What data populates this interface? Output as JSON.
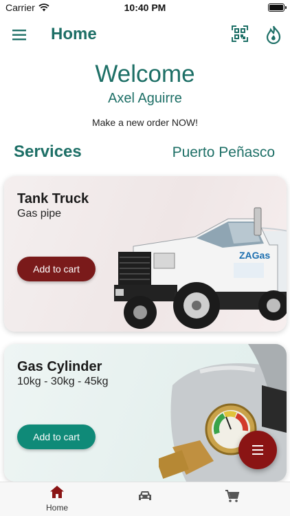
{
  "status_bar": {
    "carrier": "Carrier",
    "time": "10:40 PM"
  },
  "app_bar": {
    "title": "Home",
    "menu_icon": "hamburger-menu-icon",
    "qr_icon": "qr-scan-icon",
    "flame_icon": "flame-icon"
  },
  "hero": {
    "welcome": "Welcome",
    "user_name": "Axel Aguirre",
    "promo": "Make a new order NOW!"
  },
  "services": {
    "title": "Services",
    "city": "Puerto Peñasco",
    "cards": [
      {
        "title": "Tank Truck",
        "subtitle": "Gas pipe",
        "button": "Add to cart",
        "button_color": "#7a1a1a",
        "image": "tank-truck-image"
      },
      {
        "title": "Gas Cylinder",
        "subtitle": "10kg - 30kg - 45kg",
        "button": "Add to cart",
        "button_color": "#0f8a78",
        "image": "gas-cylinder-image"
      }
    ]
  },
  "fab": {
    "icon": "menu-icon",
    "color": "#8a1414"
  },
  "bottom_nav": [
    {
      "label": "Home",
      "icon": "home-icon",
      "active": true
    },
    {
      "label": "",
      "icon": "car-icon",
      "active": false
    },
    {
      "label": "",
      "icon": "cart-icon",
      "active": false
    }
  ],
  "colors": {
    "primary": "#1d6f66",
    "accent": "#8a1414"
  }
}
